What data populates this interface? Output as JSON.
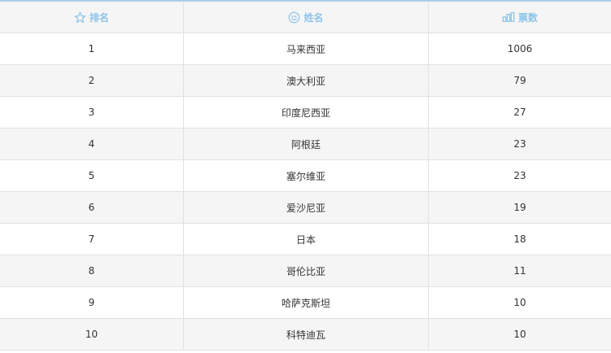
{
  "header": {
    "rank_label": "排名",
    "name_label": "姓名",
    "votes_label": "票数",
    "rank_icon": "star-icon",
    "name_icon": "smiley-icon",
    "votes_icon": "chart-icon",
    "accent_color": "#8dc4ea"
  },
  "rows": [
    {
      "rank": "1",
      "name": "马来西亚",
      "votes": "1006"
    },
    {
      "rank": "2",
      "name": "澳大利亚",
      "votes": "79"
    },
    {
      "rank": "3",
      "name": "印度尼西亚",
      "votes": "27"
    },
    {
      "rank": "4",
      "name": "阿根廷",
      "votes": "23"
    },
    {
      "rank": "5",
      "name": "塞尔维亚",
      "votes": "23"
    },
    {
      "rank": "6",
      "name": "爱沙尼亚",
      "votes": "19"
    },
    {
      "rank": "7",
      "name": "日本",
      "votes": "18"
    },
    {
      "rank": "8",
      "name": "哥伦比亚",
      "votes": "11"
    },
    {
      "rank": "9",
      "name": "哈萨克斯坦",
      "votes": "10"
    },
    {
      "rank": "10",
      "name": "科特迪瓦",
      "votes": "10"
    }
  ]
}
